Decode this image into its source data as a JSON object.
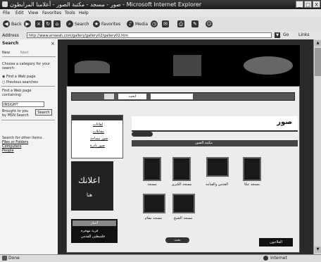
{
  "window": {
    "title": "صور - مسجد - مكتبة الصور - أعلامنا المرابطون - Microsoft Internet Explorer",
    "buttons": {
      "minimize": "_",
      "maximize": "□",
      "close": "X"
    }
  },
  "menu": [
    "File",
    "Edit",
    "View",
    "Favorites",
    "Tools",
    "Help"
  ],
  "toolbar": {
    "back_label": "Back",
    "search_label": "Search",
    "favorites_label": "Favorites",
    "media_label": "Media"
  },
  "address": {
    "label": "Address",
    "url": "http://www.arraeah.com/gallery/gallery02/gallery02.htm",
    "go_label": "Go",
    "links_label": "Links"
  },
  "search_pane": {
    "title": "Search",
    "new_label": "New",
    "next_label": "Next",
    "choose_text": "Choose a category for your search:",
    "option_web": "Find a Web page",
    "option_previous": "Previous searches",
    "find_label": "Find a Web page containing:",
    "query": "INSIGHT",
    "search_button": "Search",
    "brought_by": "Brought to you by MSN Search",
    "other_items": "Search for other items:",
    "link_files": "Files or Folders",
    "link_computers": "Computers",
    "link_people": "People"
  },
  "site": {
    "search_button": "ابحث",
    "tab_photos": "صور",
    "category_header": "مكتبة الصور",
    "sidebar_links": [
      "لقاءات",
      "مقابلات",
      "صور مساجد",
      "صور نادرة"
    ],
    "ad_text": "اعلانك",
    "ad_subtext": "هنا",
    "news_title": "أخبار",
    "news_items": [
      "قرية مهجرة",
      "فلسطين للقدس"
    ],
    "bottom_links": [
      "بحث",
      "الفلاحون"
    ],
    "photos": [
      {
        "caption": "مسجد"
      },
      {
        "caption": "مسجد الكبرى"
      },
      {
        "caption": "القدس والقيامة"
      },
      {
        "caption": "مسجد عكا"
      },
      {
        "caption": "مسجد مقام"
      },
      {
        "caption": "مسجد الشيخ"
      }
    ]
  },
  "status": {
    "left": "Done",
    "zone": "Internet"
  }
}
